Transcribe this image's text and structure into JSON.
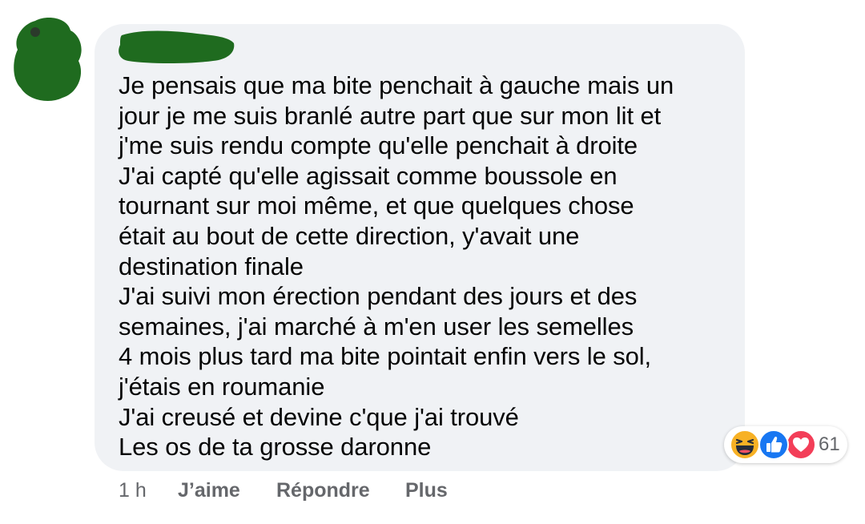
{
  "comment": {
    "lines": [
      "Je pensais que ma bite penchait à gauche mais un",
      "jour je me suis branlé autre part que sur mon lit et",
      "j'me suis rendu compte qu'elle penchait à droite",
      "J'ai capté qu'elle agissait comme boussole en",
      "tournant sur moi même, et que quelques chose",
      "était au bout de cette direction, y'avait une",
      "destination finale",
      "J'ai suivi mon érection pendant des jours et des",
      "semaines, j'ai marché à m'en user les semelles",
      "4 mois plus tard ma bite pointait enfin vers le sol,",
      "j'étais en roumanie",
      "J'ai creusé et devine c'que j'ai trouvé",
      "Les os de ta grosse daronne"
    ]
  },
  "reactions": {
    "icons": [
      "haha-icon",
      "like-icon",
      "love-icon"
    ],
    "count": "61"
  },
  "actions": {
    "time": "1 h",
    "like": "J’aime",
    "reply": "Répondre",
    "more": "Plus"
  },
  "colors": {
    "bubble": "#f0f2f5",
    "text": "#050505",
    "secondary_text": "#65676b",
    "redaction": "#1f6b1f"
  }
}
